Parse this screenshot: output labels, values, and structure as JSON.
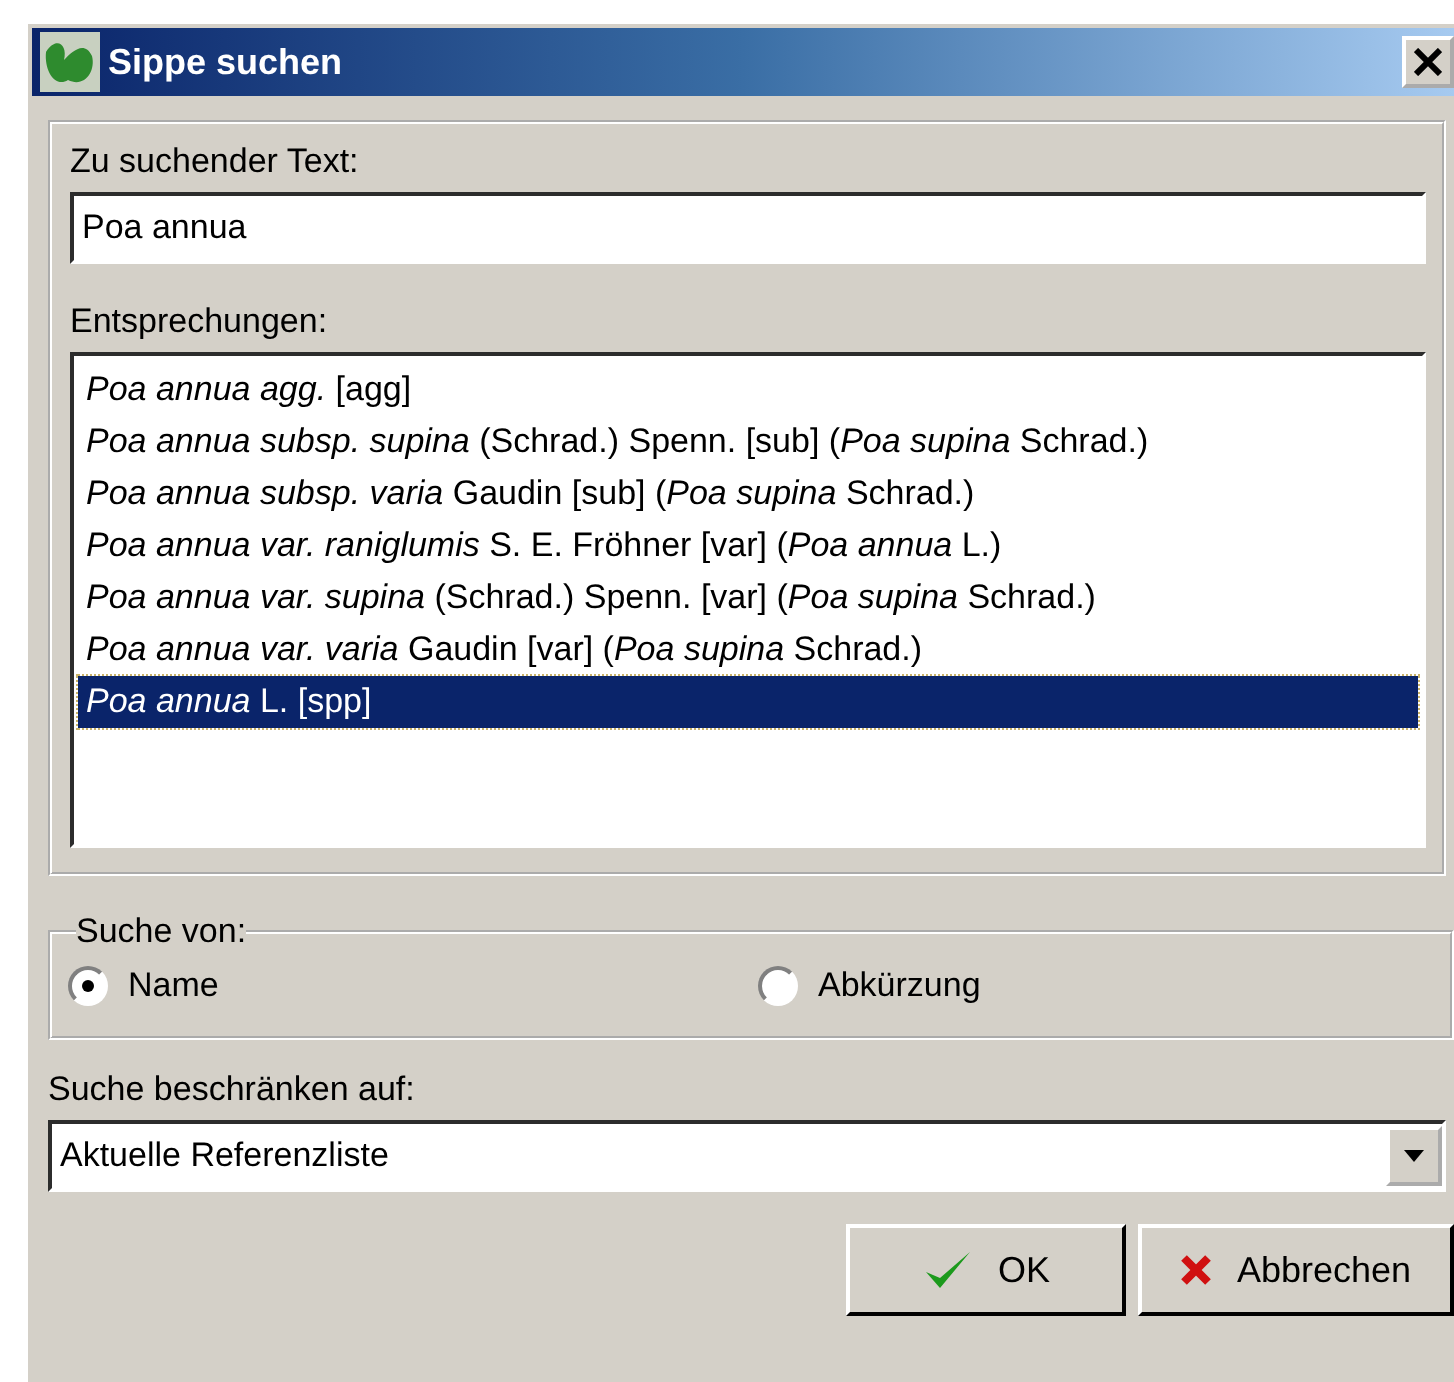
{
  "window": {
    "title": "Sippe suchen"
  },
  "search_text": {
    "label": "Zu suchender Text:",
    "value": "Poa annua"
  },
  "matches": {
    "label": "Entsprechungen:",
    "items": [
      {
        "text": "*Poa annua agg.*  [agg]",
        "selected": false
      },
      {
        "text": "*Poa annua subsp. supina* (Schrad.) Spenn. [sub] (*Poa supina* Schrad.)",
        "selected": false
      },
      {
        "text": "*Poa annua subsp. varia* Gaudin [sub] (*Poa supina* Schrad.)",
        "selected": false
      },
      {
        "text": "*Poa annua var. raniglumis* S. E. Fröhner [var] (*Poa annua* L.)",
        "selected": false
      },
      {
        "text": "*Poa annua var. supina* (Schrad.) Spenn. [var] (*Poa supina* Schrad.)",
        "selected": false
      },
      {
        "text": "*Poa annua var. varia* Gaudin [var] (*Poa supina* Schrad.)",
        "selected": false
      },
      {
        "text": "*Poa annua* L. [spp]",
        "selected": true
      }
    ]
  },
  "search_by": {
    "legend": "Suche von:",
    "options": [
      {
        "label": "Name",
        "selected": true
      },
      {
        "label": "Abkürzung",
        "selected": false
      }
    ]
  },
  "restrict": {
    "label": "Suche beschränken auf:",
    "value": "Aktuelle Referenzliste"
  },
  "buttons": [
    {
      "kind": "ok",
      "label": "OK"
    },
    {
      "kind": "cancel",
      "label": "Abbrechen"
    }
  ]
}
